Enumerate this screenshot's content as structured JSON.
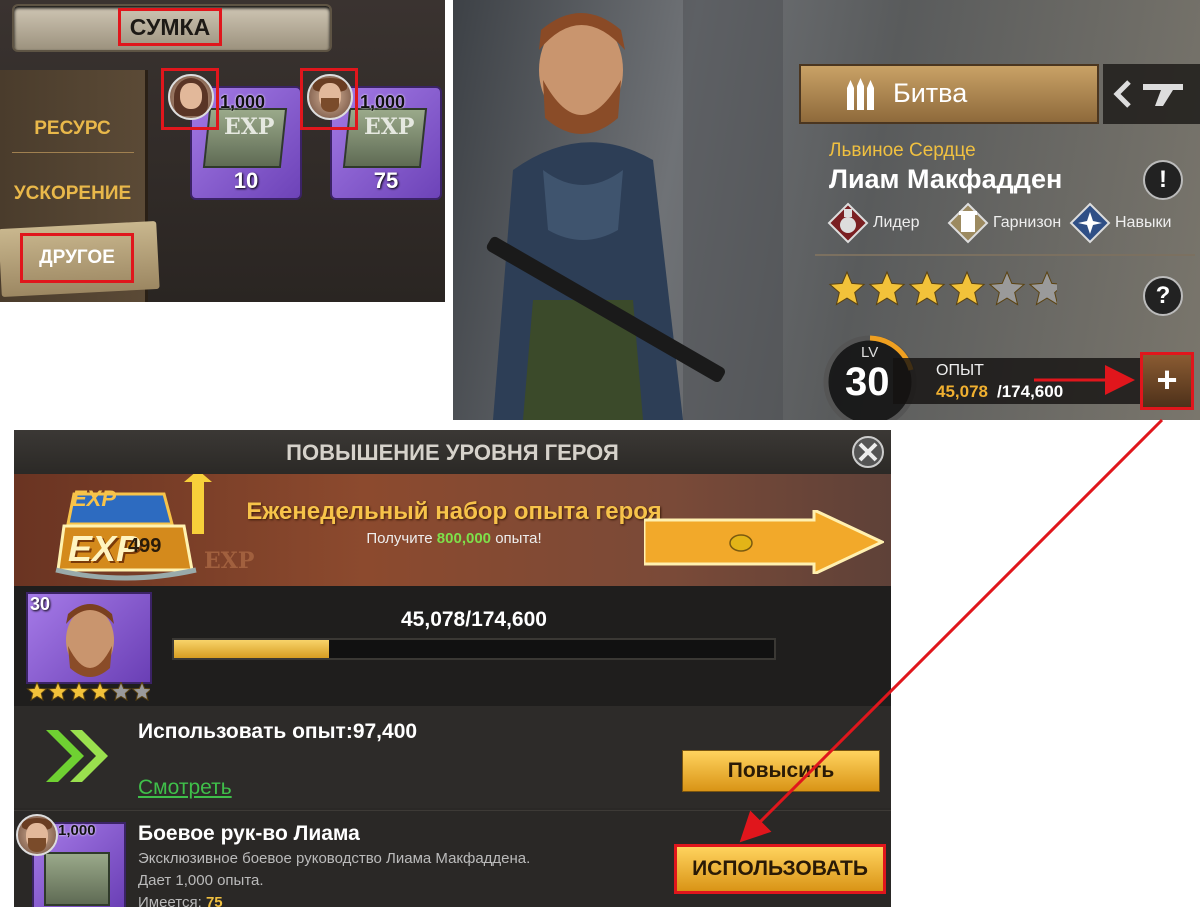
{
  "bag": {
    "title": "СУМКА",
    "tabs": {
      "resource": "РЕСУРС",
      "speedup": "УСКОРЕНИЕ",
      "other": "ДРУГОЕ"
    },
    "items": [
      {
        "exp_amount": "1,000",
        "book_label": "EXP",
        "count": "10",
        "avatar": "female-hero-avatar"
      },
      {
        "exp_amount": "1,000",
        "book_label": "EXP",
        "count": "75",
        "avatar": "liam-avatar"
      }
    ]
  },
  "hero": {
    "battle_label": "Битва",
    "title": "Львиное Сердце",
    "name": "Лиам Макфадден",
    "traits": {
      "leader": "Лидер",
      "garrison": "Гарнизон",
      "skills": "Навыки"
    },
    "stars_filled": 4,
    "stars_total": 6,
    "lv_label": "LV",
    "level": "30",
    "exp_label": "ОПЫТ",
    "exp_current": "45,078",
    "exp_max": "/174,600",
    "plus_label": "+",
    "info_label": "!",
    "help_label": "?"
  },
  "dialog": {
    "title": "ПОВЫШЕНИЕ УРОВНЯ ГЕРОЯ",
    "banner": {
      "exp_logo_top": "EXP",
      "exp_logo_main": "EXP",
      "exp_logo_bg": "EXP",
      "headline": "Еженедельный набор опыта героя",
      "sub_prefix": "Получите ",
      "sub_amount": "800,000",
      "sub_suffix": " опыта!",
      "price": "499"
    },
    "hero_card_level": "30",
    "card_stars_filled": 4,
    "card_stars_total": 6,
    "progress_text": "45,078/174,600",
    "progress_fraction": 0.258,
    "use_exp_label": "Использовать опыт:97,400",
    "view_link": "Смотреть",
    "level_up_button": "Повысить",
    "item": {
      "exp_amount": "1,000",
      "name": "Боевое рук-во Лиама",
      "desc1": "Эксклюзивное боевое руководство Лиама Макфаддена.",
      "desc2": "Дает 1,000 опыта.",
      "owned_prefix": "Имеется: ",
      "owned_count": "75",
      "use_button": "ИСПОЛЬЗОВАТЬ"
    }
  },
  "colors": {
    "highlight": "#e0161c",
    "gold": "#f0c040",
    "green": "#3fbf4a"
  }
}
